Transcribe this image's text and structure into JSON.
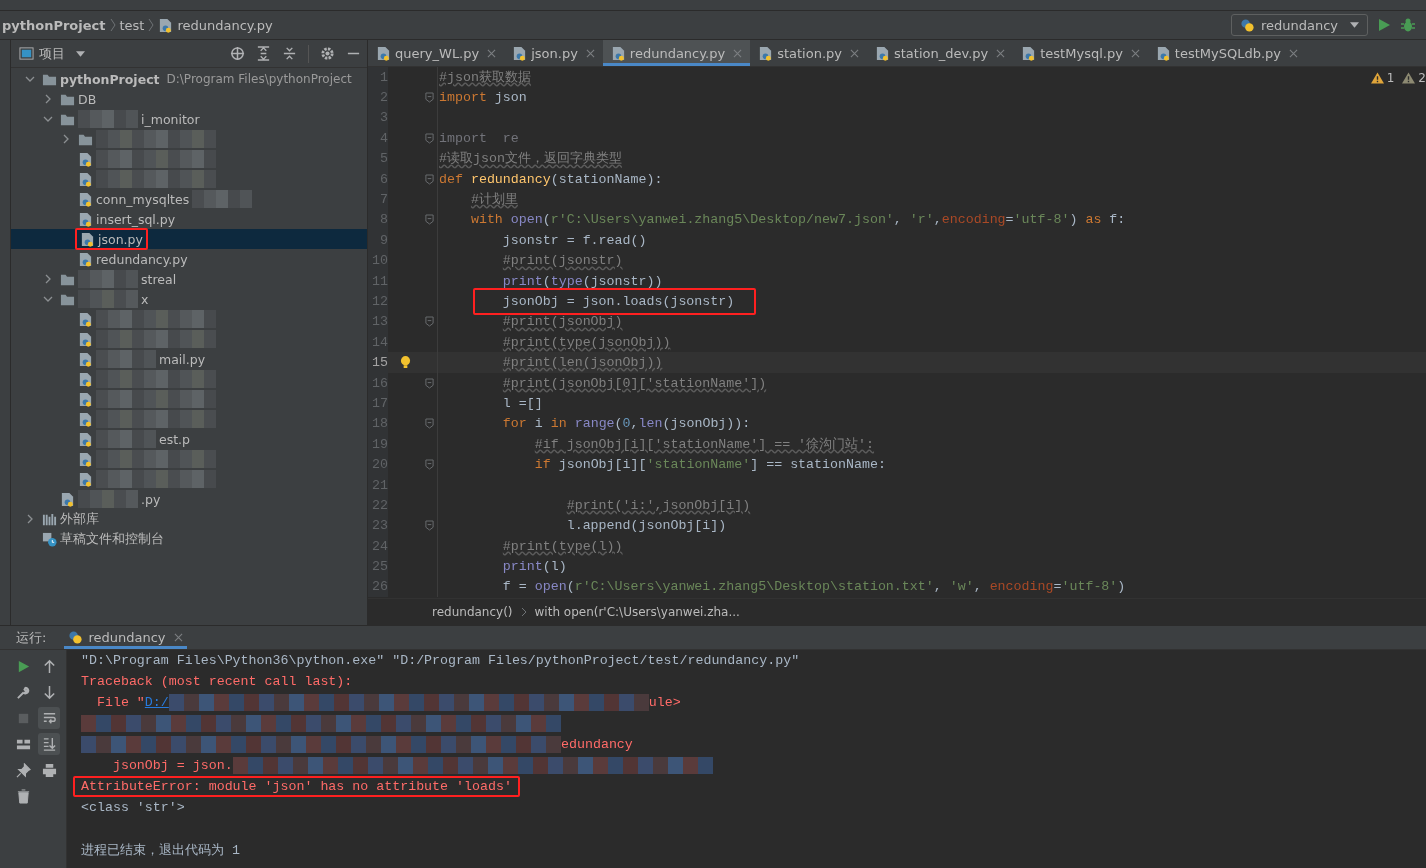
{
  "breadcrumb": [
    "pythonProject",
    "test",
    "redundancy.py"
  ],
  "run_config": {
    "label": "redundancy"
  },
  "project": {
    "title": "项目",
    "tree": [
      {
        "name": "pythonProject",
        "path": "D:\\Program Files\\pythonProject",
        "kind": "folder",
        "expanded": true,
        "selected": false,
        "children": [
          {
            "name": "DB",
            "kind": "folder",
            "expanded": false,
            "selected": false
          },
          {
            "name": "i_monitor",
            "kind": "folder",
            "expanded": true,
            "selected": false,
            "blurred_before": true,
            "children": [
              {
                "kind": "folder",
                "expanded": false,
                "selected": false,
                "blurred_before": true
              },
              {
                "kind": "file",
                "selected": false,
                "blurred_before": true
              },
              {
                "kind": "file",
                "selected": false,
                "blurred_before": true
              },
              {
                "name": "conn_mysqltes",
                "kind": "file",
                "selected": false,
                "blurred_after": true
              },
              {
                "name": "insert_sql.py",
                "kind": "file",
                "selected": false
              },
              {
                "name": "json.py",
                "kind": "file",
                "selected": true,
                "annotated": true
              },
              {
                "name": "redundancy.py",
                "kind": "file",
                "selected": false
              }
            ]
          },
          {
            "name": "streal",
            "kind": "folder",
            "expanded": false,
            "selected": false,
            "blurred_before": true
          },
          {
            "name": "x",
            "kind": "folder",
            "expanded": true,
            "selected": false,
            "blurred_before": true,
            "children": [
              {
                "kind": "file",
                "selected": false,
                "blurred_before": true
              },
              {
                "kind": "file",
                "selected": false,
                "blurred_before": true
              },
              {
                "name": "mail.py",
                "kind": "file",
                "selected": false,
                "blurred_before": true
              },
              {
                "kind": "file",
                "selected": false,
                "blurred_before": true
              },
              {
                "kind": "file",
                "selected": false,
                "blurred_before": true
              },
              {
                "kind": "file",
                "selected": false,
                "blurred_before": true
              },
              {
                "name": "est.p",
                "kind": "file",
                "selected": false,
                "blurred_before": true
              },
              {
                "kind": "file",
                "selected": false,
                "blurred_before": true
              },
              {
                "kind": "file",
                "selected": false,
                "blurred_before": true
              }
            ]
          },
          {
            "name": ".py",
            "kind": "file",
            "selected": false,
            "blurred_before": true
          }
        ]
      },
      {
        "name": "外部库",
        "kind": "library",
        "expanded": false,
        "selected": false
      },
      {
        "name": "草稿文件和控制台",
        "kind": "scratch",
        "selected": false
      }
    ]
  },
  "tabs": [
    {
      "label": "query_WL.py",
      "selected": false
    },
    {
      "label": "json.py",
      "selected": false
    },
    {
      "label": "redundancy.py",
      "selected": true
    },
    {
      "label": "station.py",
      "selected": false
    },
    {
      "label": "station_dev.py",
      "selected": false
    },
    {
      "label": "testMysql.py",
      "selected": false
    },
    {
      "label": "testMySQLdb.py",
      "selected": false
    }
  ],
  "inspections": [
    {
      "count": "1",
      "kind": "warning"
    },
    {
      "count": "2",
      "kind": "weak"
    }
  ],
  "code": [
    {
      "number": "1",
      "fold": false,
      "current": false,
      "tokens": [
        {
          "kind": "cm",
          "text": "#json获取数据"
        }
      ]
    },
    {
      "number": "2",
      "fold": true,
      "current": false,
      "tokens": [
        {
          "kind": "kw",
          "text": "import"
        },
        {
          "kind": "pl",
          "text": " json"
        }
      ]
    },
    {
      "number": "3",
      "fold": false,
      "current": false
    },
    {
      "number": "4",
      "fold": true,
      "current": false,
      "tokens": [
        {
          "kind": "dim",
          "text": "import  re"
        }
      ]
    },
    {
      "number": "5",
      "fold": false,
      "current": false,
      "tokens": [
        {
          "kind": "cm",
          "text": "#读取json文件，返回字典类型"
        }
      ]
    },
    {
      "number": "6",
      "fold": true,
      "current": false,
      "tokens": [
        {
          "kind": "kw",
          "text": "def "
        },
        {
          "kind": "fn",
          "text": "redundancy"
        },
        {
          "kind": "pl",
          "text": "(stationName):"
        }
      ]
    },
    {
      "number": "7",
      "fold": false,
      "current": false,
      "tokens": [
        {
          "kind": "cm",
          "text": "    #计划里"
        }
      ]
    },
    {
      "number": "8",
      "fold": true,
      "current": false,
      "tokens": [
        {
          "kind": "kw",
          "text": "    with "
        },
        {
          "kind": "bi",
          "text": "open"
        },
        {
          "kind": "pl",
          "text": "("
        },
        {
          "kind": "str",
          "text": "r'C:\\Users\\yanwei.zhang5\\Desktop/new7.json'"
        },
        {
          "kind": "pl",
          "text": ", "
        },
        {
          "kind": "str",
          "text": "'r'"
        },
        {
          "kind": "pl",
          "text": ","
        },
        {
          "kind": "kwarg",
          "text": "encoding"
        },
        {
          "kind": "pl",
          "text": "="
        },
        {
          "kind": "str",
          "text": "'utf-8'"
        },
        {
          "kind": "pl",
          "text": ") "
        },
        {
          "kind": "kw",
          "text": "as"
        },
        {
          "kind": "pl",
          "text": " f:"
        }
      ]
    },
    {
      "number": "9",
      "fold": false,
      "current": false,
      "tokens": [
        {
          "kind": "pl",
          "text": "        jsonstr = f.read()"
        }
      ]
    },
    {
      "number": "10",
      "fold": false,
      "current": false,
      "tokens": [
        {
          "kind": "cm",
          "text": "        #print(jsonstr)"
        }
      ]
    },
    {
      "number": "11",
      "fold": false,
      "current": false,
      "tokens": [
        {
          "kind": "bi",
          "text": "        print"
        },
        {
          "kind": "pl",
          "text": "("
        },
        {
          "kind": "bi",
          "text": "type"
        },
        {
          "kind": "pl",
          "text": "(jsonstr))"
        }
      ]
    },
    {
      "number": "12",
      "fold": false,
      "current": false,
      "annotated": true,
      "tokens": [
        {
          "kind": "pl",
          "text": "        jsonObj = json.loads(jsonstr)"
        }
      ]
    },
    {
      "number": "13",
      "fold": true,
      "current": false,
      "tokens": [
        {
          "kind": "cm",
          "text": "        #print(jsonObj)"
        }
      ]
    },
    {
      "number": "14",
      "fold": false,
      "current": false,
      "tokens": [
        {
          "kind": "cm",
          "text": "        #print(type(jsonObj))"
        }
      ]
    },
    {
      "number": "15",
      "fold": false,
      "current": true,
      "hint": true,
      "tokens": [
        {
          "kind": "cm",
          "text": "        #print(len(jsonObj))"
        }
      ]
    },
    {
      "number": "16",
      "fold": true,
      "current": false,
      "tokens": [
        {
          "kind": "cm",
          "text": "        #print(jsonObj[0]['stationName'])"
        }
      ]
    },
    {
      "number": "17",
      "fold": false,
      "current": false,
      "tokens": [
        {
          "kind": "pl",
          "text": "        l =[]"
        }
      ]
    },
    {
      "number": "18",
      "fold": true,
      "current": false,
      "tokens": [
        {
          "kind": "kw",
          "text": "        for"
        },
        {
          "kind": "pl",
          "text": " i "
        },
        {
          "kind": "kw",
          "text": "in"
        },
        {
          "kind": "bi",
          "text": " range"
        },
        {
          "kind": "pl",
          "text": "("
        },
        {
          "kind": "num",
          "text": "0"
        },
        {
          "kind": "pl",
          "text": ","
        },
        {
          "kind": "bi",
          "text": "len"
        },
        {
          "kind": "pl",
          "text": "(jsonObj)):"
        }
      ]
    },
    {
      "number": "19",
      "fold": false,
      "current": false,
      "tokens": [
        {
          "kind": "cm",
          "text": "            #if jsonObj[i]['stationName'] == '徐沟门站':"
        }
      ]
    },
    {
      "number": "20",
      "fold": true,
      "current": false,
      "tokens": [
        {
          "kind": "kw",
          "text": "            if"
        },
        {
          "kind": "pl",
          "text": " jsonObj[i]["
        },
        {
          "kind": "str",
          "text": "'stationName'"
        },
        {
          "kind": "pl",
          "text": "] == stationName:"
        }
      ]
    },
    {
      "number": "21",
      "fold": false,
      "current": false
    },
    {
      "number": "22",
      "fold": false,
      "current": false,
      "tokens": [
        {
          "kind": "cm",
          "text": "                #print('i:',jsonObj[i])"
        }
      ]
    },
    {
      "number": "23",
      "fold": true,
      "current": false,
      "tokens": [
        {
          "kind": "pl",
          "text": "                l.append(jsonObj[i])"
        }
      ]
    },
    {
      "number": "24",
      "fold": false,
      "current": false,
      "tokens": [
        {
          "kind": "cm",
          "text": "        #print(type(l))"
        }
      ]
    },
    {
      "number": "25",
      "fold": false,
      "current": false,
      "tokens": [
        {
          "kind": "bi",
          "text": "        print"
        },
        {
          "kind": "pl",
          "text": "(l)"
        }
      ]
    },
    {
      "number": "26",
      "fold": false,
      "current": false,
      "tokens": [
        {
          "kind": "pl",
          "text": "        f = "
        },
        {
          "kind": "bi",
          "text": "open"
        },
        {
          "kind": "pl",
          "text": "("
        },
        {
          "kind": "str",
          "text": "r'C:\\Users\\yanwei.zhang5\\Desktop\\station.txt'"
        },
        {
          "kind": "pl",
          "text": ", "
        },
        {
          "kind": "str",
          "text": "'w'"
        },
        {
          "kind": "pl",
          "text": ", "
        },
        {
          "kind": "kwarg",
          "text": "encoding"
        },
        {
          "kind": "pl",
          "text": "="
        },
        {
          "kind": "str",
          "text": "'utf-8'"
        },
        {
          "kind": "pl",
          "text": ")"
        }
      ]
    }
  ],
  "editor_breadcrumb": [
    "redundancy()",
    "with open(r'C:\\Users\\yanwei.zha..."
  ],
  "run": {
    "label": "运行:",
    "tab": "redundancy",
    "tools": [
      {
        "kind": "rerun",
        "on": false
      },
      {
        "kind": "up",
        "on": false
      },
      {
        "kind": "wrench",
        "on": false
      },
      {
        "kind": "down",
        "on": false
      },
      {
        "kind": "stop",
        "on": false
      },
      {
        "kind": "wrap",
        "on": true
      },
      {
        "kind": "layout",
        "on": false
      },
      {
        "kind": "scroll-end",
        "on": true
      },
      {
        "kind": "pin",
        "on": false
      },
      {
        "kind": "print",
        "on": false
      },
      {
        "kind": "trash",
        "on": false
      }
    ],
    "lines": [
      {
        "kind": "command",
        "parts": [
          {
            "kind": "text",
            "text": "\"D:\\Program Files\\Python36\\python.exe\" \"D:/Program Files/pythonProject/test/redundancy.py\""
          }
        ]
      },
      {
        "kind": "error",
        "parts": [
          {
            "kind": "text",
            "text": "Traceback (most recent call last):"
          }
        ]
      },
      {
        "kind": "error",
        "parts": [
          {
            "kind": "text",
            "text": "  File \""
          },
          {
            "kind": "link",
            "text": "D:/"
          },
          {
            "kind": "redacted"
          },
          {
            "kind": "text",
            "text": "ule>"
          }
        ]
      },
      {
        "kind": "error",
        "parts": [
          {
            "kind": "redacted"
          }
        ]
      },
      {
        "kind": "error",
        "parts": [
          {
            "kind": "redacted"
          },
          {
            "kind": "text",
            "text": "edundancy"
          }
        ]
      },
      {
        "kind": "error",
        "parts": [
          {
            "kind": "text",
            "text": "    jsonObj = json."
          },
          {
            "kind": "redacted"
          }
        ]
      },
      {
        "kind": "error",
        "annotated": true,
        "parts": [
          {
            "kind": "text",
            "text": "AttributeError: module 'json' has no attribute 'loads'"
          }
        ]
      },
      {
        "kind": "output",
        "parts": [
          {
            "kind": "text",
            "text": "<class 'str'>"
          }
        ]
      },
      {
        "kind": "blank"
      },
      {
        "kind": "output",
        "parts": [
          {
            "kind": "text",
            "text": "进程已结束，退出代码为 1"
          }
        ]
      }
    ]
  }
}
